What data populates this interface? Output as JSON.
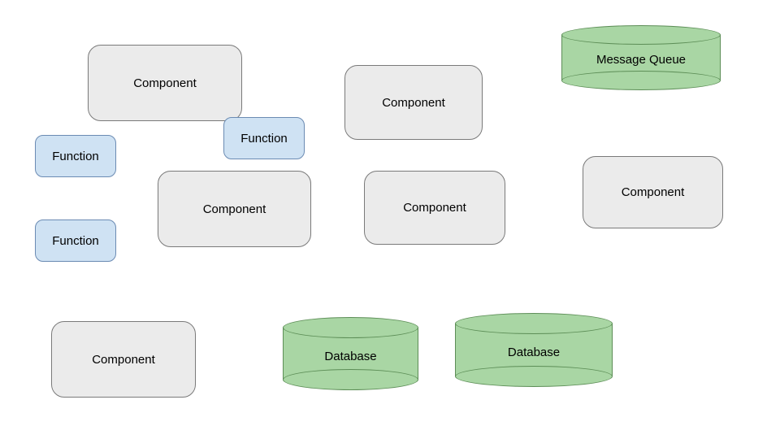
{
  "shapes": {
    "component1": {
      "label": "Component"
    },
    "component2": {
      "label": "Component"
    },
    "component3": {
      "label": "Component"
    },
    "component4": {
      "label": "Component"
    },
    "component5": {
      "label": "Component"
    },
    "component6": {
      "label": "Component"
    },
    "function1": {
      "label": "Function"
    },
    "function2": {
      "label": "Function"
    },
    "function3": {
      "label": "Function"
    },
    "messageQueue": {
      "label": "Message Queue"
    },
    "database1": {
      "label": "Database"
    },
    "database2": {
      "label": "Database"
    }
  },
  "colors": {
    "componentFill": "#ebebeb",
    "componentStroke": "#7a7a7a",
    "functionFill": "#cfe2f3",
    "functionStroke": "#6b8bb3",
    "dataFill": "#a9d6a4",
    "dataStroke": "#5d8e57"
  }
}
